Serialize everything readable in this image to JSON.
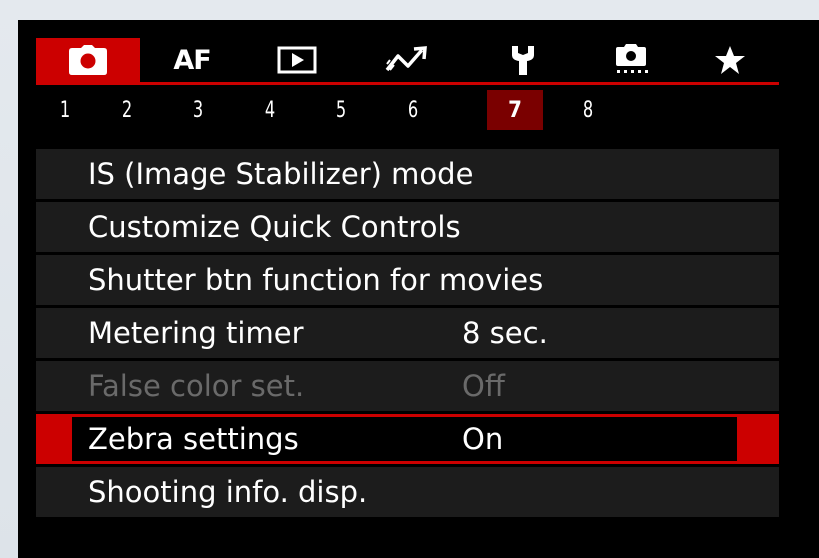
{
  "tabs": [
    {
      "name": "shooting",
      "icon": "camera-icon",
      "active": true
    },
    {
      "name": "af",
      "label": "AF",
      "active": false
    },
    {
      "name": "playback",
      "icon": "playback-icon",
      "active": false
    },
    {
      "name": "wireless",
      "icon": "wireless-icon",
      "active": false
    },
    {
      "name": "setup",
      "icon": "wrench-icon",
      "active": false
    },
    {
      "name": "custom-functions",
      "icon": "custom-camera-icon",
      "active": false
    },
    {
      "name": "my-menu",
      "icon": "star-icon",
      "active": false
    }
  ],
  "pages": [
    "1",
    "2",
    "3",
    "4",
    "5",
    "6",
    "7",
    "8"
  ],
  "active_page": "7",
  "menu": {
    "items": [
      {
        "label": "IS (Image Stabilizer) mode",
        "value": ""
      },
      {
        "label": "Customize Quick Controls",
        "value": ""
      },
      {
        "label": "Shutter btn function for movies",
        "value": ""
      },
      {
        "label": "Metering timer",
        "value": "8 sec."
      },
      {
        "label": "False color set.",
        "value": "Off",
        "disabled": true
      },
      {
        "label": "Zebra settings",
        "value": "On",
        "selected": true
      },
      {
        "label": "Shooting info. disp.",
        "value": ""
      }
    ]
  },
  "colors": {
    "accent": "#cc0000",
    "active_page_bg": "#7a0000",
    "row_bg": "#1c1c1c",
    "disabled_text": "#6a6a6a"
  }
}
